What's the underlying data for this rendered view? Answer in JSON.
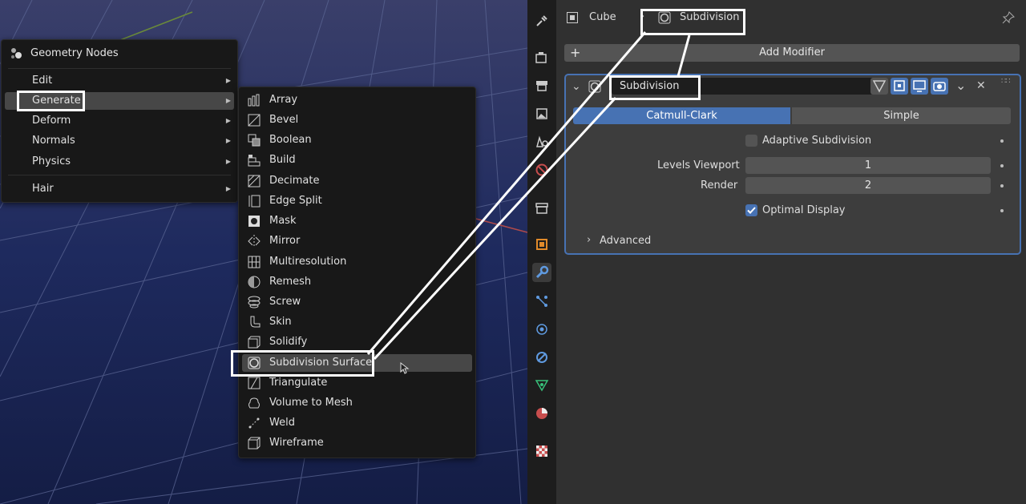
{
  "viewport_menu": {
    "title": "Geometry Nodes",
    "title_icon": "geometry-nodes-icon",
    "items": [
      {
        "label": "Edit",
        "has_submenu": true
      },
      {
        "label": "Generate",
        "has_submenu": true,
        "highlighted": true
      },
      {
        "label": "Deform",
        "has_submenu": true
      },
      {
        "label": "Normals",
        "has_submenu": true
      },
      {
        "label": "Physics",
        "has_submenu": true
      },
      {
        "label": "Hair",
        "has_submenu": true
      }
    ]
  },
  "generate_submenu": {
    "items": [
      {
        "label": "Array",
        "icon": "array-icon"
      },
      {
        "label": "Bevel",
        "icon": "bevel-icon"
      },
      {
        "label": "Boolean",
        "icon": "boolean-icon"
      },
      {
        "label": "Build",
        "icon": "build-icon"
      },
      {
        "label": "Decimate",
        "icon": "decimate-icon"
      },
      {
        "label": "Edge Split",
        "icon": "edge-split-icon"
      },
      {
        "label": "Mask",
        "icon": "mask-icon"
      },
      {
        "label": "Mirror",
        "icon": "mirror-icon"
      },
      {
        "label": "Multiresolution",
        "icon": "multiresolution-icon"
      },
      {
        "label": "Remesh",
        "icon": "remesh-icon"
      },
      {
        "label": "Screw",
        "icon": "screw-icon"
      },
      {
        "label": "Skin",
        "icon": "skin-icon"
      },
      {
        "label": "Solidify",
        "icon": "solidify-icon"
      },
      {
        "label": "Subdivision Surface",
        "icon": "subdivision-surface-icon",
        "highlighted": true
      },
      {
        "label": "Triangulate",
        "icon": "triangulate-icon"
      },
      {
        "label": "Volume to Mesh",
        "icon": "volume-to-mesh-icon"
      },
      {
        "label": "Weld",
        "icon": "weld-icon"
      },
      {
        "label": "Wireframe",
        "icon": "wireframe-icon"
      }
    ]
  },
  "properties": {
    "breadcrumb": {
      "object": "Cube",
      "modifier": "Subdivision"
    },
    "add_modifier_label": "Add Modifier",
    "add_icon": "+",
    "modifier": {
      "name": "Subdivision",
      "type_tabs": [
        "Catmull-Clark",
        "Simple"
      ],
      "active_type": "Catmull-Clark",
      "adaptive_label": "Adaptive Subdivision",
      "adaptive_checked": false,
      "levels_viewport_label": "Levels Viewport",
      "levels_viewport_value": "1",
      "render_label": "Render",
      "render_value": "2",
      "optimal_display_label": "Optimal Display",
      "optimal_display_checked": true,
      "advanced_label": "Advanced"
    }
  },
  "colors": {
    "accent_blue": "#4772b3",
    "highlight_white": "#ffffff"
  }
}
